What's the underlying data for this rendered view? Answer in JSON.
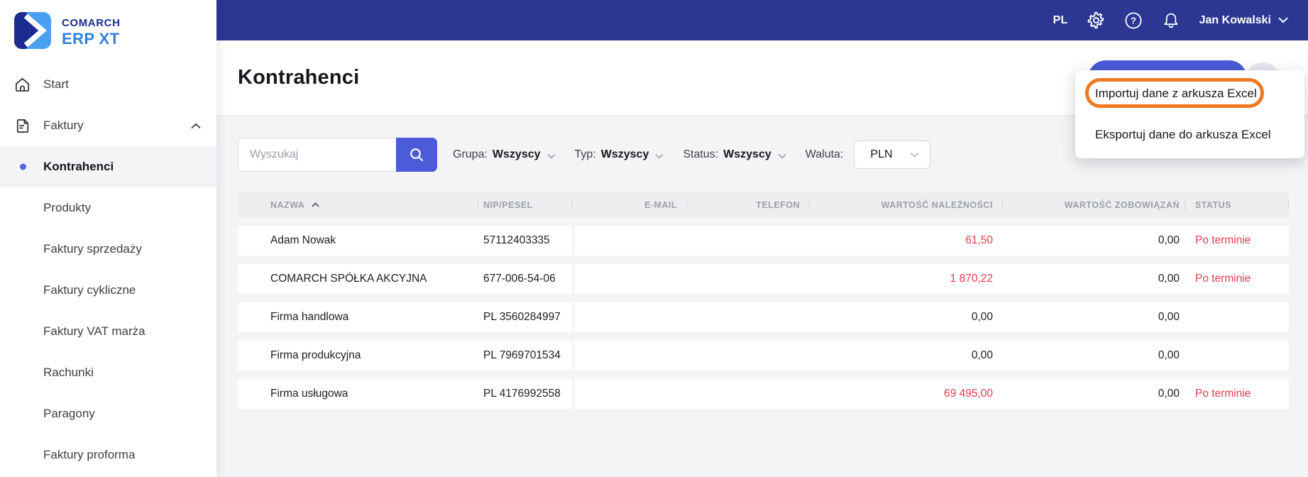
{
  "topbar": {
    "language": "PL",
    "user": "Jan Kowalski"
  },
  "sidebar": {
    "brand_line1": "COMARCH",
    "brand_line2": "ERP XT",
    "items": [
      {
        "label": "Start"
      },
      {
        "label": "Faktury"
      }
    ],
    "sub_items": [
      {
        "label": "Kontrahenci",
        "active": true
      },
      {
        "label": "Produkty"
      },
      {
        "label": "Faktury sprzedaży"
      },
      {
        "label": "Faktury cykliczne"
      },
      {
        "label": "Faktury VAT marża"
      },
      {
        "label": "Rachunki"
      },
      {
        "label": "Paragony"
      },
      {
        "label": "Faktury proforma"
      }
    ]
  },
  "page": {
    "title": "Kontrahenci"
  },
  "toolbar": {
    "search_placeholder": "Wyszukaj",
    "filters": [
      {
        "label": "Grupa:",
        "value": "Wszyscy"
      },
      {
        "label": "Typ:",
        "value": "Wszyscy"
      },
      {
        "label": "Status:",
        "value": "Wszyscy"
      }
    ],
    "currency_label": "Waluta:",
    "currency_value": "PLN"
  },
  "menu": {
    "items": [
      "Importuj dane z arkusza Excel",
      "Eksportuj dane do arkusza Excel"
    ]
  },
  "table": {
    "columns": [
      "NAZWA",
      "NIP/PESEL",
      "E-MAIL",
      "TELEFON",
      "WARTOŚĆ NALEŻNOŚCI",
      "WARTOŚĆ ZOBOWIĄZAŃ",
      "STATUS"
    ],
    "rows": [
      {
        "name": "Adam Nowak",
        "nip": "57112403335",
        "email": "",
        "phone": "",
        "receivables": "61,50",
        "liabilities": "0,00",
        "status": "Po terminie"
      },
      {
        "name": "COMARCH SPÓŁKA AKCYJNA",
        "nip": "677-006-54-06",
        "email": "",
        "phone": "",
        "receivables": "1 870,22",
        "liabilities": "0,00",
        "status": "Po terminie"
      },
      {
        "name": "Firma handlowa",
        "nip": "PL 3560284997",
        "email": "",
        "phone": "",
        "receivables": "0,00",
        "liabilities": "0,00",
        "status": ""
      },
      {
        "name": "Firma produkcyjna",
        "nip": "PL 7969701534",
        "email": "",
        "phone": "",
        "receivables": "0,00",
        "liabilities": "0,00",
        "status": ""
      },
      {
        "name": "Firma usługowa",
        "nip": "PL 4176992558",
        "email": "",
        "phone": "",
        "receivables": "69 495,00",
        "liabilities": "0,00",
        "status": "Po terminie"
      }
    ],
    "colors": {
      "accent": "#4c5cd9",
      "topbar": "#2b3793",
      "alert": "#e23b4e",
      "annotation": "#ee7b22"
    }
  }
}
